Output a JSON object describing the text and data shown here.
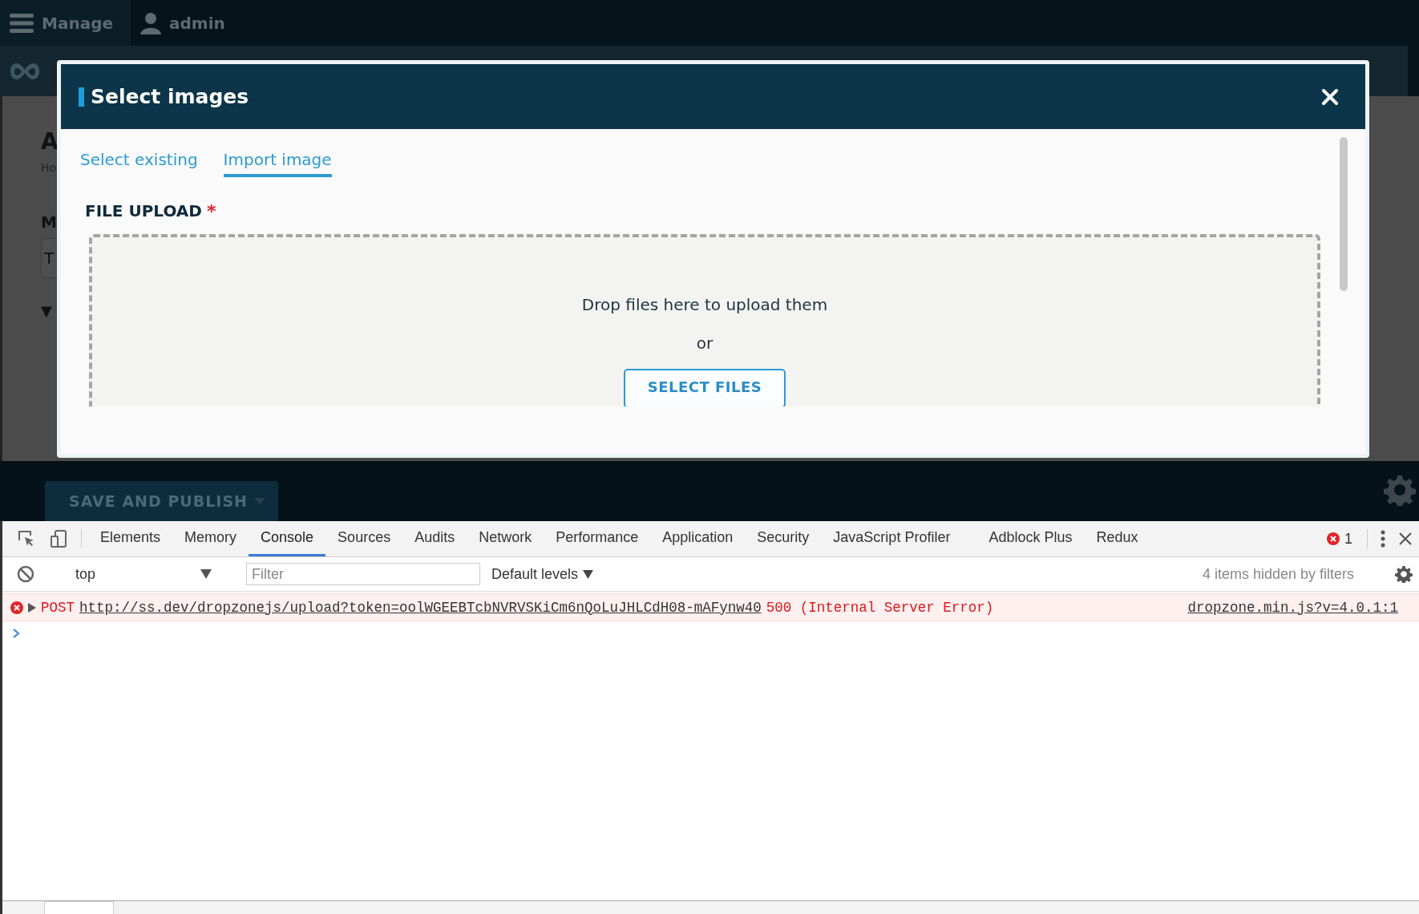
{
  "top_bar": {
    "items": [
      {
        "label": "Manage",
        "kind": "menu"
      },
      {
        "label": "admin",
        "kind": "user"
      }
    ]
  },
  "page": {
    "heading": "A",
    "breadcrumb": "Ho",
    "field_label": "M",
    "field_value": "T",
    "toggle": "▼",
    "save_button": "SAVE AND PUBLISH"
  },
  "modal": {
    "title": "Select images",
    "tabs": [
      {
        "label": "Select existing",
        "selected": false
      },
      {
        "label": "Import image",
        "selected": true
      }
    ],
    "field_label": "FILE UPLOAD",
    "required_mark": "*",
    "dropzone": {
      "message": "Drop files here to upload them",
      "separator": "or",
      "button": "SELECT FILES"
    }
  },
  "devtools": {
    "tabs": [
      {
        "label": "Elements",
        "selected": false
      },
      {
        "label": "Memory",
        "selected": false
      },
      {
        "label": "Console",
        "selected": true
      },
      {
        "label": "Sources",
        "selected": false
      },
      {
        "label": "Audits",
        "selected": false
      },
      {
        "label": "Network",
        "selected": false
      },
      {
        "label": "Performance",
        "selected": false
      },
      {
        "label": "Application",
        "selected": false
      },
      {
        "label": "Security",
        "selected": false
      },
      {
        "label": "JavaScript Profiler",
        "selected": false
      },
      {
        "label": "Adblock Plus",
        "selected": false
      },
      {
        "label": "Redux",
        "selected": false
      }
    ],
    "error_count": "1",
    "context": "top",
    "filter_placeholder": "Filter",
    "levels": "Default levels",
    "hidden_note": "4 items hidden by filters",
    "messages": [
      {
        "kind": "error",
        "method": "POST",
        "url": "http://ss.dev/dropzonejs/upload?token=oolWGEEBTcbNVRVSKiCm6nQoLuJHLCdH08-mAFynw40",
        "status": "500 (Internal Server Error)",
        "source": "dropzone.min.js?v=4.0.1:1"
      }
    ]
  }
}
